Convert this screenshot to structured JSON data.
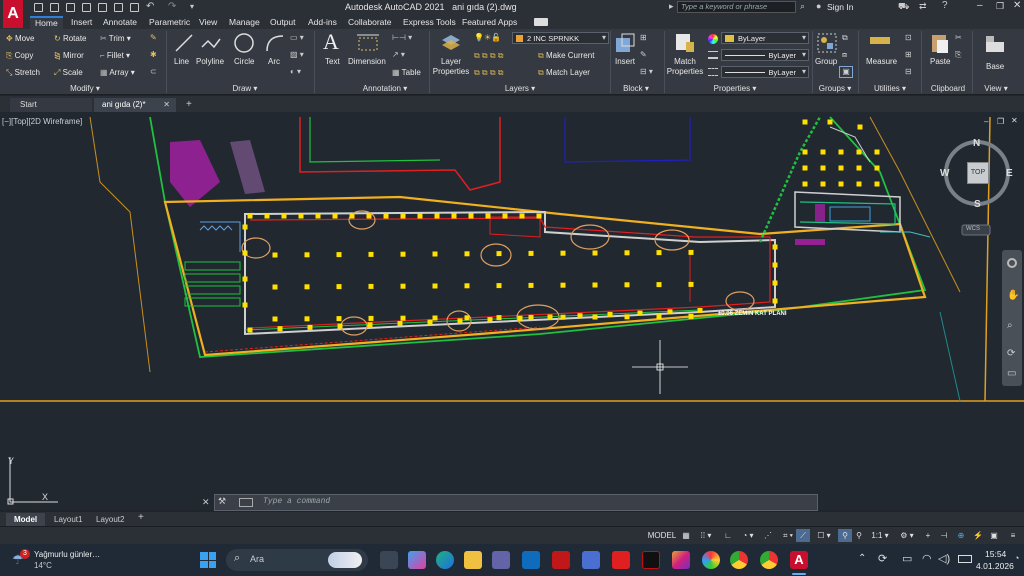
{
  "app": {
    "title": "Autodesk AutoCAD 2021",
    "document": "ani gıda (2).dwg",
    "search_placeholder": "Type a keyword or phrase",
    "sign_in": "Sign In"
  },
  "ribbon_tabs": [
    "Home",
    "Insert",
    "Annotate",
    "Parametric",
    "View",
    "Manage",
    "Output",
    "Add-ins",
    "Collaborate",
    "Express Tools",
    "Featured Apps"
  ],
  "modify": {
    "title": "Modify",
    "move": "Move",
    "rotate": "Rotate",
    "trim": "Trim",
    "copy": "Copy",
    "mirror": "Mirror",
    "fillet": "Fillet",
    "stretch": "Stretch",
    "scale": "Scale",
    "array": "Array"
  },
  "draw": {
    "title": "Draw",
    "line": "Line",
    "polyline": "Polyline",
    "circle": "Circle",
    "arc": "Arc"
  },
  "annotation": {
    "title": "Annotation",
    "text": "Text",
    "dimension": "Dimension",
    "table": "Table"
  },
  "layers": {
    "title": "Layers",
    "layer_properties": "Layer Properties",
    "current_layer": "2 INC SPRNKK",
    "make_current": "Make Current",
    "match_layer": "Match Layer"
  },
  "block": {
    "title": "Block",
    "insert": "Insert"
  },
  "properties": {
    "title": "Properties",
    "match": "Match Properties",
    "color": "ByLayer",
    "linetype": "ByLayer",
    "lineweight": "ByLayer"
  },
  "groups": {
    "title": "Groups",
    "group": "Group"
  },
  "utilities": {
    "title": "Utilities",
    "measure": "Measure"
  },
  "clipboard": {
    "title": "Clipboard",
    "paste": "Paste"
  },
  "view": {
    "title": "View",
    "base": "Base"
  },
  "file_tabs": {
    "start": "Start",
    "current": "ani gıda (2)*"
  },
  "viewport": {
    "label": "[−][Top][2D Wireframe]",
    "compass": {
      "n": "N",
      "s": "S",
      "e": "E",
      "w": "W",
      "top": "TOP"
    },
    "wcs": "WCS",
    "drawing_text": "±0.06 ZEMIN KAT PLANI"
  },
  "command": {
    "placeholder": "Type a command"
  },
  "layout_tabs": [
    "Model",
    "Layout1",
    "Layout2"
  ],
  "status": {
    "model": "MODEL",
    "scale": "1:1"
  },
  "taskbar": {
    "weather_title": "Yağmurlu günler…",
    "weather_temp": "14°C",
    "weather_badge": "3",
    "search": "Ara",
    "time": "15:54",
    "date": "4.01.2026"
  },
  "colors": {
    "accent": "#2d7fd8",
    "bg_canvas": "#212830",
    "ribbon": "#353a42",
    "autocad_red": "#c8102e"
  }
}
